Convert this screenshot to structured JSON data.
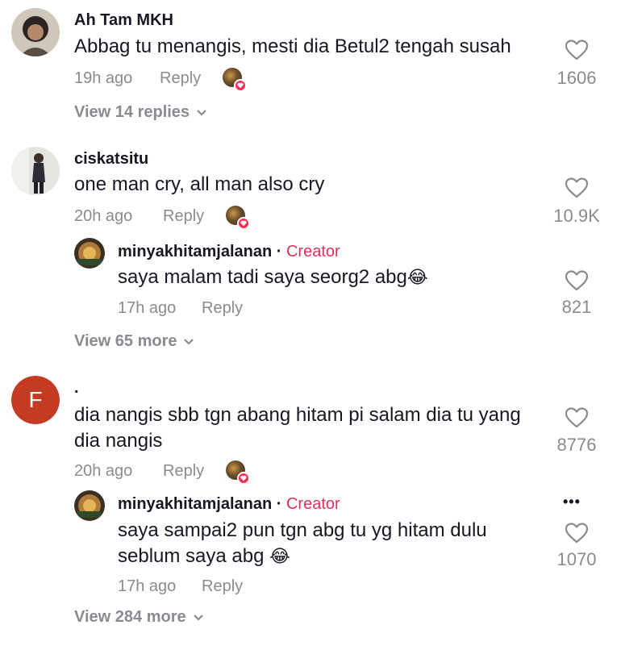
{
  "comments": [
    {
      "username": "Ah Tam MKH",
      "text": "Abbag tu menangis, mesti dia Betul2 tengah susah",
      "time": "19h ago",
      "reply_label": "Reply",
      "likes": "1606",
      "view_replies": "View 14 replies"
    },
    {
      "username": "ciskatsitu",
      "text": "one man cry, all man also cry",
      "time": "20h ago",
      "reply_label": "Reply",
      "likes": "10.9K",
      "reply": {
        "username": "minyakhitamjalanan",
        "separator": " · ",
        "creator_label": "Creator",
        "text": "saya malam tadi saya seorg2 abg",
        "emoji": "😂",
        "time": "17h ago",
        "reply_label": "Reply",
        "likes": "821"
      },
      "view_more": "View 65 more"
    },
    {
      "username": ".",
      "avatar_letter": "F",
      "avatar_color": "#c23b22",
      "text": "dia nangis sbb tgn abang hitam pi salam dia tu yang dia nangis",
      "time": "20h ago",
      "reply_label": "Reply",
      "likes": "8776",
      "reply": {
        "username": "minyakhitamjalanan",
        "separator": " · ",
        "creator_label": "Creator",
        "text": "saya sampai2 pun tgn abg tu yg hitam dulu seblum saya abg",
        "emoji": "😂",
        "time": "17h ago",
        "reply_label": "Reply",
        "likes": "1070",
        "more_options": "•••"
      },
      "view_more": "View 284 more"
    }
  ],
  "colors": {
    "creator": "#e0305a",
    "muted": "#8a8b91",
    "heart_badge": "#fe2c55"
  }
}
